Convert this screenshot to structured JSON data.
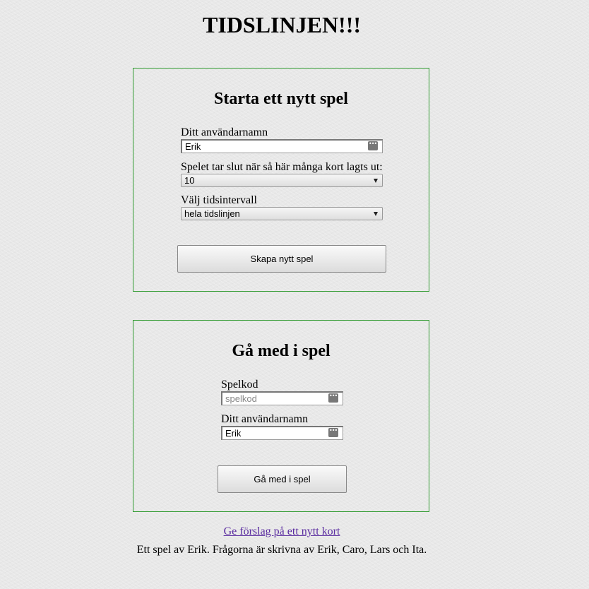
{
  "page": {
    "title": "TIDSLINJEN!!!"
  },
  "create_game": {
    "heading": "Starta ett nytt spel",
    "username_label": "Ditt användarnamn",
    "username_value": "Erik",
    "cards_label": "Spelet tar slut när så här många kort lagts ut:",
    "cards_selected": "10",
    "interval_label": "Välj tidsintervall",
    "interval_selected": "hela tidslinjen",
    "submit_label": "Skapa nytt spel"
  },
  "join_game": {
    "heading": "Gå med i spel",
    "code_label": "Spelkod",
    "code_placeholder": "spelkod",
    "username_label": "Ditt användarnamn",
    "username_value": "Erik",
    "submit_label": "Gå med i spel"
  },
  "footer": {
    "suggest_link": "Ge förslag på ett nytt kort",
    "credit": "Ett spel av Erik. Frågorna är skrivna av Erik, Caro, Lars och Ita."
  },
  "colors": {
    "panel_border": "#2f9a2f",
    "link": "#5a2ca0",
    "background": "#e8e8e8"
  },
  "icons": {
    "field_autofill": "dots-icon",
    "select_arrow": "chevron-down-icon"
  }
}
